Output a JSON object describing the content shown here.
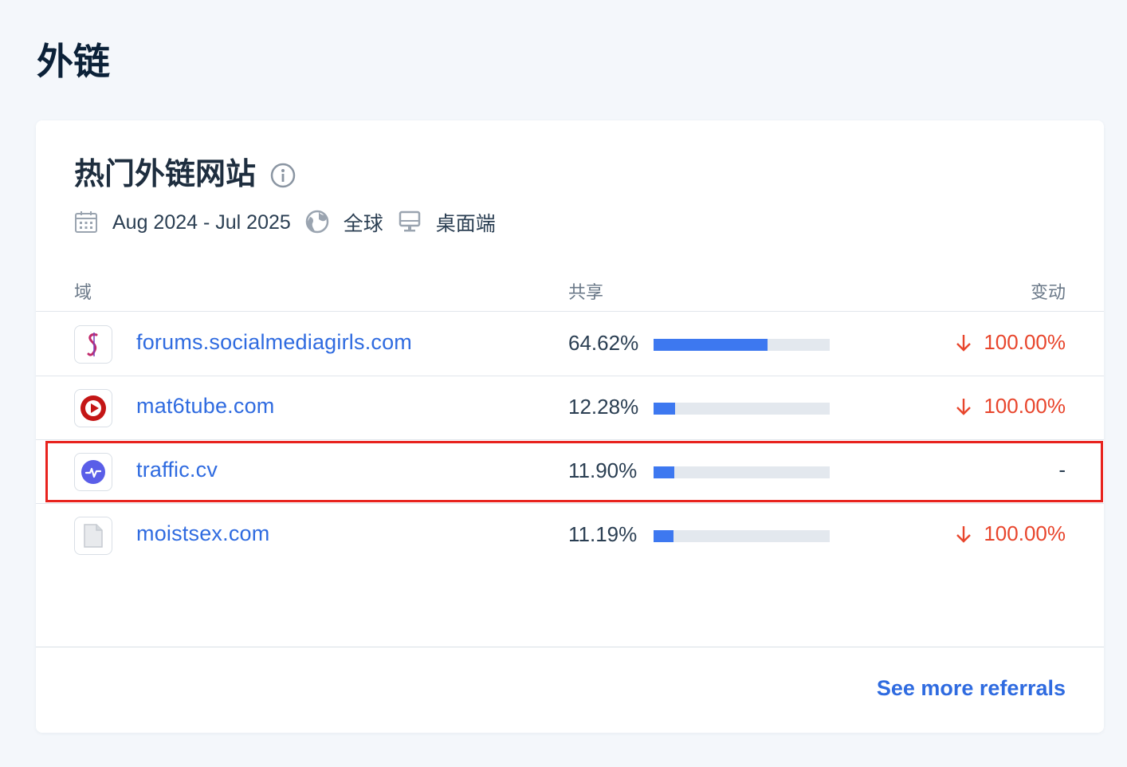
{
  "page": {
    "title": "外链"
  },
  "card": {
    "title": "热门外链网站",
    "date_range": "Aug 2024 - Jul 2025",
    "region": "全球",
    "device": "桌面端",
    "icons": [
      "info-icon",
      "calendar-icon",
      "globe-icon",
      "desktop-icon"
    ]
  },
  "table": {
    "columns": {
      "domain": "域",
      "share": "共享",
      "change": "变动"
    },
    "rows": [
      {
        "domain": "forums.socialmediagirls.com",
        "share": "64.62%",
        "share_fraction": 0.6462,
        "change": "100.00%",
        "change_direction": "down",
        "favicon": "smg-logo-icon"
      },
      {
        "domain": "mat6tube.com",
        "share": "12.28%",
        "share_fraction": 0.1228,
        "change": "100.00%",
        "change_direction": "down",
        "favicon": "play-button-icon"
      },
      {
        "domain": "traffic.cv",
        "share": "11.90%",
        "share_fraction": 0.119,
        "change": "-",
        "change_direction": "none",
        "favicon": "pulse-icon",
        "highlighted": true
      },
      {
        "domain": "moistsex.com",
        "share": "11.19%",
        "share_fraction": 0.1119,
        "change": "100.00%",
        "change_direction": "down",
        "favicon": "generic-page-icon"
      }
    ]
  },
  "footer": {
    "link_label": "See more referrals"
  },
  "colors": {
    "accent": "#2f6be0",
    "bar": "#3d78f0",
    "decrease": "#e8452c",
    "highlight": "#e8231e"
  }
}
